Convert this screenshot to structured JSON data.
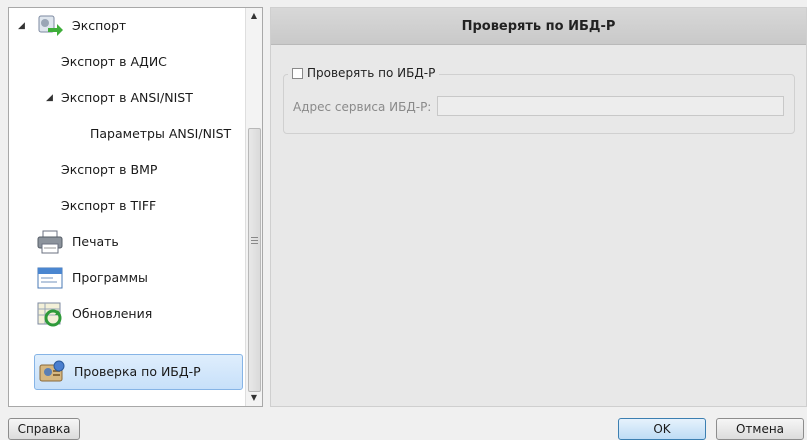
{
  "tree": {
    "items": [
      {
        "label": "Экспорт"
      },
      {
        "label": "Экспорт в АДИС"
      },
      {
        "label": "Экспорт в ANSI/NIST"
      },
      {
        "label": "Параметры ANSI/NIST"
      },
      {
        "label": "Экспорт в BMP"
      },
      {
        "label": "Экспорт в TIFF"
      },
      {
        "label": "Печать"
      },
      {
        "label": "Программы"
      },
      {
        "label": "Обновления"
      },
      {
        "label": "Проверка по ИБД-Р"
      }
    ],
    "selected": "Проверка по ИБД-Р"
  },
  "panel": {
    "title": "Проверять по ИБД-Р",
    "group_checkbox_label": "Проверять по ИБД-Р",
    "checkbox_checked": false,
    "address_label": "Адрес сервиса ИБД-Р:",
    "address_value": ""
  },
  "buttons": {
    "help": "Справка",
    "ok": "OK",
    "cancel": "Отмена"
  },
  "colors": {
    "accent": "#3c7fb1",
    "selection": "#c7e0fa",
    "header": "#d0d0d0"
  }
}
